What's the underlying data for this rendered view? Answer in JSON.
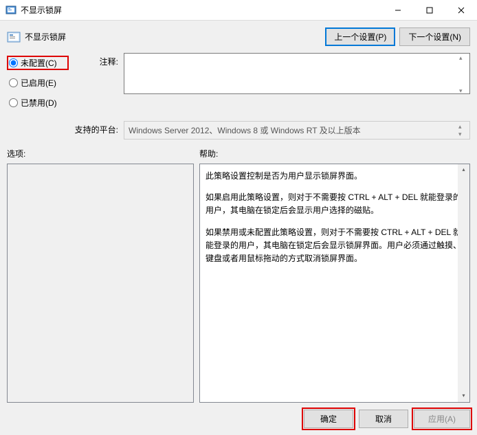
{
  "titlebar": {
    "title": "不显示锁屏"
  },
  "header": {
    "title": "不显示锁屏",
    "prev_btn": "上一个设置(P)",
    "next_btn": "下一个设置(N)"
  },
  "radios": {
    "not_configured": "未配置(C)",
    "enabled": "已启用(E)",
    "disabled": "已禁用(D)"
  },
  "labels": {
    "comment": "注释:",
    "platforms": "支持的平台:",
    "options": "选项:",
    "help": "帮助:"
  },
  "platforms_text": "Windows Server 2012、Windows 8 或 Windows RT 及以上版本",
  "help_text": {
    "p1": "此策略设置控制是否为用户显示锁屏界面。",
    "p2": "如果启用此策略设置，则对于不需要按 CTRL + ALT + DEL  就能登录的用户，其电脑在锁定后会显示用户选择的磁贴。",
    "p3": "如果禁用或未配置此策略设置，则对于不需要按 CTRL + ALT + DEL 就能登录的用户，其电脑在锁定后会显示锁屏界面。用户必须通过触摸、键盘或者用鼠标拖动的方式取消锁屏界面。"
  },
  "footer": {
    "ok": "确定",
    "cancel": "取消",
    "apply": "应用(A)"
  }
}
